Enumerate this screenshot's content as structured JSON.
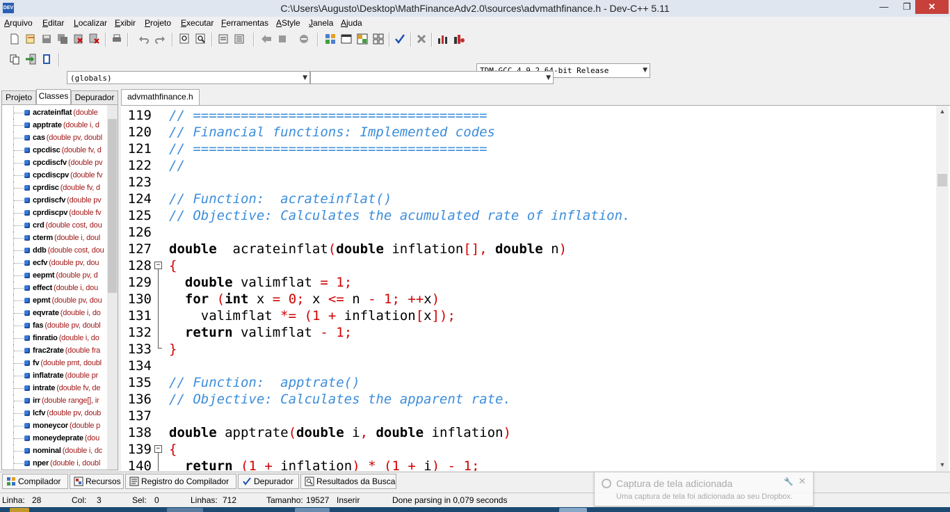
{
  "window": {
    "title": "C:\\Users\\Augusto\\Desktop\\MathFinanceAdv2.0\\sources\\advmathfinance.h - Dev-C++ 5.11",
    "app_icon_label": "DEV",
    "minimize": "—",
    "maximize": "❐",
    "close": "✕"
  },
  "menu": [
    "Arquivo",
    "Editar",
    "Localizar",
    "Exibir",
    "Projeto",
    "Executar",
    "Ferramentas",
    "AStyle",
    "Janela",
    "Ajuda"
  ],
  "toolbar": {
    "compiler_select": "TDM-GCC 4.9.2 64-bit Release",
    "scope_select": "(globals)",
    "member_select": ""
  },
  "left_panel": {
    "tabs": [
      "Projeto",
      "Classes",
      "Depurador"
    ],
    "active_tab": "Classes",
    "classes": [
      {
        "name": "acrateinflat",
        "sig": "(double"
      },
      {
        "name": "apptrate",
        "sig": "(double i, d"
      },
      {
        "name": "cas",
        "sig": "(double pv, doubl"
      },
      {
        "name": "cpcdisc",
        "sig": "(double fv, d"
      },
      {
        "name": "cpcdiscfv",
        "sig": "(double pv"
      },
      {
        "name": "cpcdiscpv",
        "sig": "(double fv"
      },
      {
        "name": "cprdisc",
        "sig": "(double fv, d"
      },
      {
        "name": "cprdiscfv",
        "sig": "(double pv"
      },
      {
        "name": "cprdiscpv",
        "sig": "(double fv"
      },
      {
        "name": "crd",
        "sig": "(double cost, dou"
      },
      {
        "name": "cterm",
        "sig": "(double i, doul"
      },
      {
        "name": "ddb",
        "sig": "(double cost, dou"
      },
      {
        "name": "ecfv",
        "sig": "(double pv, dou"
      },
      {
        "name": "eepmt",
        "sig": "(double pv, d"
      },
      {
        "name": "effect",
        "sig": "(double i, dou"
      },
      {
        "name": "epmt",
        "sig": "(double pv, dou"
      },
      {
        "name": "eqvrate",
        "sig": "(double i, do"
      },
      {
        "name": "fas",
        "sig": "(double pv, doubl"
      },
      {
        "name": "finratio",
        "sig": "(double i, do"
      },
      {
        "name": "frac2rate",
        "sig": "(double fra"
      },
      {
        "name": "fv",
        "sig": "(double pmt, doubl"
      },
      {
        "name": "inflatrate",
        "sig": "(double pr"
      },
      {
        "name": "intrate",
        "sig": "(double fv, de"
      },
      {
        "name": "irr",
        "sig": "(double range[], ir"
      },
      {
        "name": "lcfv",
        "sig": "(double pv, doub"
      },
      {
        "name": "moneycor",
        "sig": "(double p"
      },
      {
        "name": "moneydeprate",
        "sig": "(dou"
      },
      {
        "name": "nominal",
        "sig": "(double i, dc"
      },
      {
        "name": "nper",
        "sig": "(double i, doubl"
      }
    ]
  },
  "editor": {
    "tab": "advmathfinance.h",
    "line_numbers": [
      "119",
      "120",
      "121",
      "122",
      "123",
      "124",
      "125",
      "126",
      "127",
      "128",
      "129",
      "130",
      "131",
      "132",
      "133",
      "134",
      "135",
      "136",
      "137",
      "138",
      "139",
      "140"
    ],
    "lines": [
      [
        [
          "cm",
          "// ====================================="
        ]
      ],
      [
        [
          "cm",
          "// Financial functions: Implemented codes"
        ]
      ],
      [
        [
          "cm",
          "// ====================================="
        ]
      ],
      [
        [
          "cm",
          "//"
        ]
      ],
      [],
      [
        [
          "cm",
          "// Function:  acrateinflat()"
        ]
      ],
      [
        [
          "cm",
          "// Objective: Calculates the acumulated rate of inflation."
        ]
      ],
      [],
      [
        [
          "kw",
          "double"
        ],
        [
          "",
          "  acrateinflat"
        ],
        [
          "sym",
          "("
        ],
        [
          "kw",
          "double"
        ],
        [
          "",
          " inflation"
        ],
        [
          "sym",
          "[], "
        ],
        [
          "kw",
          "double"
        ],
        [
          "",
          " n"
        ],
        [
          "sym",
          ")"
        ]
      ],
      [
        [
          "sym",
          "{"
        ]
      ],
      [
        [
          "",
          "  "
        ],
        [
          "kw",
          "double"
        ],
        [
          "",
          " valimflat "
        ],
        [
          "sym",
          "="
        ],
        [
          "",
          " "
        ],
        [
          "num",
          "1"
        ],
        [
          "sym",
          ";"
        ]
      ],
      [
        [
          "",
          "  "
        ],
        [
          "kw",
          "for"
        ],
        [
          "",
          " "
        ],
        [
          "sym",
          "("
        ],
        [
          "kw",
          "int"
        ],
        [
          "",
          " x "
        ],
        [
          "sym",
          "="
        ],
        [
          "",
          " "
        ],
        [
          "num",
          "0"
        ],
        [
          "sym",
          ";"
        ],
        [
          "",
          " x "
        ],
        [
          "sym",
          "<="
        ],
        [
          "",
          " n "
        ],
        [
          "sym",
          "-"
        ],
        [
          "",
          " "
        ],
        [
          "num",
          "1"
        ],
        [
          "sym",
          ";"
        ],
        [
          "",
          " "
        ],
        [
          "sym",
          "++"
        ],
        [
          "",
          "x"
        ],
        [
          "sym",
          ")"
        ]
      ],
      [
        [
          "",
          "    valimflat "
        ],
        [
          "sym",
          "*="
        ],
        [
          "",
          " "
        ],
        [
          "sym",
          "("
        ],
        [
          "num",
          "1"
        ],
        [
          "",
          " "
        ],
        [
          "sym",
          "+"
        ],
        [
          "",
          " inflation"
        ],
        [
          "sym",
          "["
        ],
        [
          "",
          "x"
        ],
        [
          "sym",
          "]);"
        ]
      ],
      [
        [
          "",
          "  "
        ],
        [
          "kw",
          "return"
        ],
        [
          "",
          " valimflat "
        ],
        [
          "sym",
          "-"
        ],
        [
          "",
          " "
        ],
        [
          "num",
          "1"
        ],
        [
          "sym",
          ";"
        ]
      ],
      [
        [
          "sym",
          "}"
        ]
      ],
      [],
      [
        [
          "cm",
          "// Function:  apptrate()"
        ]
      ],
      [
        [
          "cm",
          "// Objective: Calculates the apparent rate."
        ]
      ],
      [],
      [
        [
          "kw",
          "double"
        ],
        [
          "",
          " apptrate"
        ],
        [
          "sym",
          "("
        ],
        [
          "kw",
          "double"
        ],
        [
          "",
          " i"
        ],
        [
          "sym",
          ", "
        ],
        [
          "kw",
          "double"
        ],
        [
          "",
          " inflation"
        ],
        [
          "sym",
          ")"
        ]
      ],
      [
        [
          "sym",
          "{"
        ]
      ],
      [
        [
          "",
          "  "
        ],
        [
          "kw",
          "return"
        ],
        [
          "",
          " "
        ],
        [
          "sym",
          "("
        ],
        [
          "num",
          "1"
        ],
        [
          "",
          " "
        ],
        [
          "sym",
          "+"
        ],
        [
          "",
          " inflation"
        ],
        [
          "sym",
          ")"
        ],
        [
          "",
          " "
        ],
        [
          "sym",
          "*"
        ],
        [
          "",
          " "
        ],
        [
          "sym",
          "("
        ],
        [
          "num",
          "1"
        ],
        [
          "",
          " "
        ],
        [
          "sym",
          "+"
        ],
        [
          "",
          " i"
        ],
        [
          "sym",
          ")"
        ],
        [
          "",
          " "
        ],
        [
          "sym",
          "-"
        ],
        [
          "",
          " "
        ],
        [
          "num",
          "1"
        ],
        [
          "sym",
          ";"
        ]
      ]
    ]
  },
  "bottom_tabs": [
    {
      "label": "Compilador",
      "icon": "grid-icon"
    },
    {
      "label": "Recursos",
      "icon": "resources-icon"
    },
    {
      "label": "Registro do Compilador",
      "icon": "log-icon"
    },
    {
      "label": "Depurador",
      "icon": "check-icon"
    },
    {
      "label": "Resultados da Busca",
      "icon": "search-results-icon"
    }
  ],
  "toast": {
    "title": "Captura de tela adicionada",
    "body": "Uma captura de tela foi adicionada ao seu Dropbox.",
    "close": "✕",
    "pin": "🔧"
  },
  "status": {
    "line_label": "Linha:",
    "line": "28",
    "col_label": "Col:",
    "col": "3",
    "sel_label": "Sel:",
    "sel": "0",
    "lines_label": "Linhas:",
    "lines": "712",
    "size_label": "Tamanho:",
    "size": "19527",
    "mode": "Inserir",
    "message": "Done parsing in 0,079 seconds"
  },
  "colors": {
    "comment": "#3c8dda",
    "symbol": "#d00000",
    "keyword": "#000000",
    "close_button": "#c7403a",
    "taskbar": "#1c4a73"
  }
}
